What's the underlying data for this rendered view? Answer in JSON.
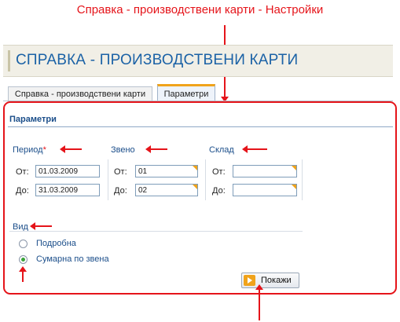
{
  "annotation": {
    "caption": "Справка - производствени карти - Настройки",
    "color": "#e5141a"
  },
  "header": {
    "title": "СПРАВКА - ПРОИЗВОДСТВЕНИ КАРТИ"
  },
  "tabs": [
    {
      "label": "Справка - производствени карти",
      "active": false
    },
    {
      "label": "Параметри",
      "active": true
    }
  ],
  "panel": {
    "title": "Параметри",
    "period": {
      "label": "Период",
      "required_mark": "*",
      "from_label": "От:",
      "from_value": "01.03.2009",
      "to_label": "До:",
      "to_value": "31.03.2009"
    },
    "unit": {
      "label": "Звено",
      "from_label": "От:",
      "from_value": "01",
      "to_label": "До:",
      "to_value": "02"
    },
    "warehouse": {
      "label": "Склад",
      "from_label": "От:",
      "from_value": "",
      "to_label": "До:",
      "to_value": ""
    },
    "view": {
      "label": "Вид",
      "options": [
        {
          "label": "Подробна",
          "selected": false
        },
        {
          "label": "Сумарна по звена",
          "selected": true
        }
      ]
    },
    "show_button": {
      "label": "Покажи",
      "icon": "arrow-right-icon"
    }
  },
  "colors": {
    "accent": "#1b62a6",
    "tab_highlight": "#f0a31b",
    "radio_selected": "#3aa33a"
  }
}
